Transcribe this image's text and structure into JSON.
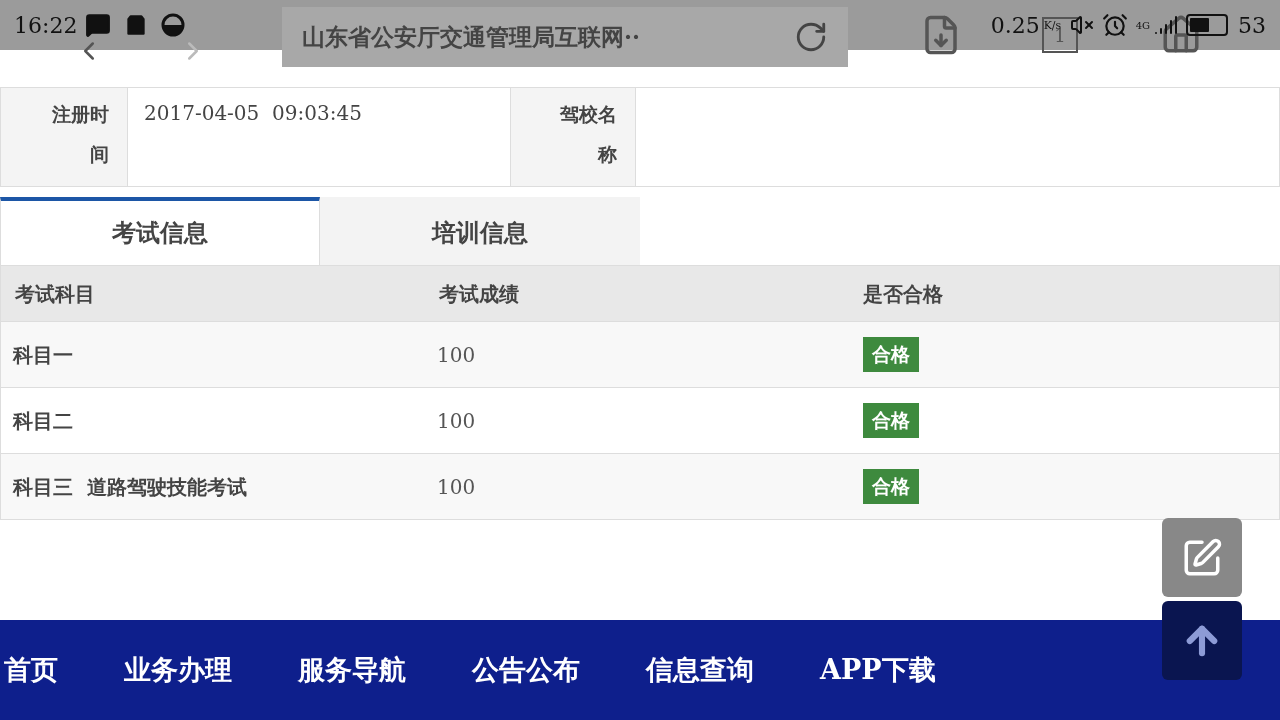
{
  "status_bar": {
    "time": "16:22",
    "speed": "0.25",
    "speed_unit": "K/s",
    "network": "4G",
    "battery": "53"
  },
  "browser": {
    "title": "山东省公安厅交通管理局互联网··",
    "tab_count": "1"
  },
  "details": [
    {
      "label": "注册时间",
      "value": "2017-04-05  09:03:45"
    },
    {
      "label": "驾校名称"
    }
  ],
  "tabs": [
    {
      "label": "考试信息",
      "selected": true
    },
    {
      "label": "培训信息",
      "selected": false
    }
  ],
  "exam_table": {
    "columns": [
      "考试科目",
      "考试成绩",
      "是否合格"
    ],
    "rows": [
      {
        "subject": "科目一",
        "score": "100",
        "result": "合格"
      },
      {
        "subject": "科目二",
        "score": "100",
        "result": "合格"
      },
      {
        "subject": "科目三  道路驾驶技能考试",
        "score": "100",
        "result": "合格"
      }
    ]
  },
  "nav": [
    "首页",
    "业务办理",
    "服务导航",
    "公告公布",
    "信息查询",
    "APP下载"
  ]
}
